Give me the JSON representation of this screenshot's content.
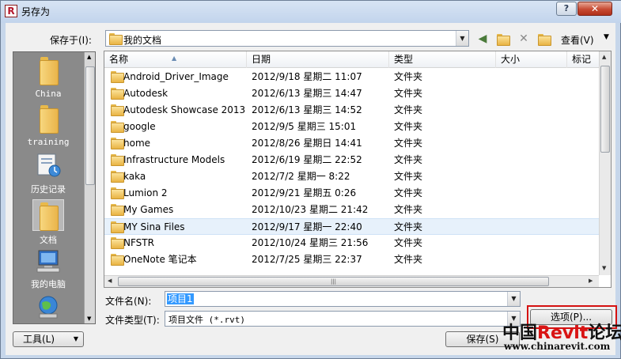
{
  "window": {
    "title": "另存为",
    "help": "?",
    "close": "✕",
    "app_icon_letter": "R"
  },
  "savein": {
    "label": "保存于(I):",
    "value": "我的文档",
    "view_label": "查看(V)"
  },
  "places": [
    {
      "label": "China",
      "icon": "folder-icon"
    },
    {
      "label": "training",
      "icon": "folder-icon"
    },
    {
      "label": "历史记录",
      "icon": "history-icon"
    },
    {
      "label": "文档",
      "icon": "documents-icon"
    },
    {
      "label": "我的电脑",
      "icon": "computer-icon"
    },
    {
      "label": "",
      "icon": "network-icon"
    }
  ],
  "columns": {
    "name": "名称",
    "date": "日期",
    "type": "类型",
    "size": "大小",
    "tags": "标记"
  },
  "files": [
    {
      "name": "Android_Driver_Image",
      "date": "2012/9/18 星期二 11:07",
      "type": "文件夹"
    },
    {
      "name": "Autodesk",
      "date": "2012/6/13 星期三 14:47",
      "type": "文件夹"
    },
    {
      "name": "Autodesk Showcase 2013",
      "date": "2012/6/13 星期三 14:52",
      "type": "文件夹"
    },
    {
      "name": "google",
      "date": "2012/9/5 星期三 15:01",
      "type": "文件夹"
    },
    {
      "name": "home",
      "date": "2012/8/26 星期日 14:41",
      "type": "文件夹"
    },
    {
      "name": "Infrastructure Models",
      "date": "2012/6/19 星期二 22:52",
      "type": "文件夹"
    },
    {
      "name": "kaka",
      "date": "2012/7/2 星期一 8:22",
      "type": "文件夹"
    },
    {
      "name": "Lumion 2",
      "date": "2012/9/21 星期五 0:26",
      "type": "文件夹"
    },
    {
      "name": "My Games",
      "date": "2012/10/23 星期二 21:42",
      "type": "文件夹"
    },
    {
      "name": "MY Sina Files",
      "date": "2012/9/17 星期一 22:40",
      "type": "文件夹"
    },
    {
      "name": "NFSTR",
      "date": "2012/10/24 星期三 21:56",
      "type": "文件夹"
    },
    {
      "name": "OneNote 笔记本",
      "date": "2012/7/25 星期三 22:37",
      "type": "文件夹"
    }
  ],
  "filename": {
    "label": "文件名(N):",
    "value": "项目1"
  },
  "filetype": {
    "label": "文件类型(T):",
    "value": "项目文件 (*.rvt)"
  },
  "buttons": {
    "options": "选项(P)...",
    "tools": "工具(L)",
    "save": "保存(S)"
  },
  "watermark": {
    "prefix": "中国",
    "brand": "Revit",
    "suffix": "论坛",
    "url": "www.chinarevit.com"
  },
  "colors": {
    "accent_highlight": "#d51212",
    "selection": "#3399ff",
    "hover_row": "#e7f1fb"
  }
}
